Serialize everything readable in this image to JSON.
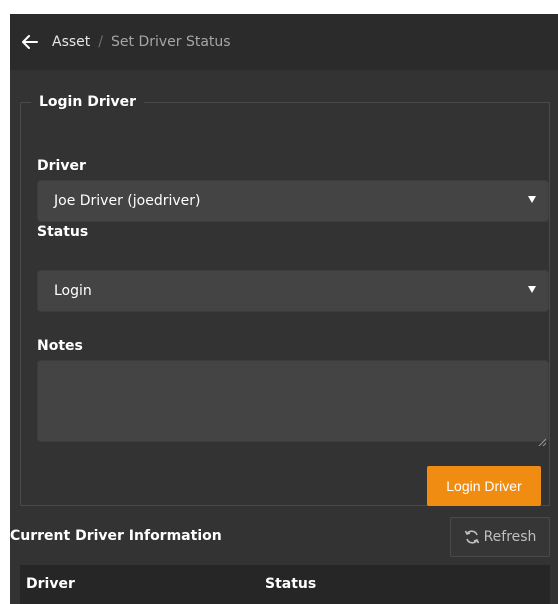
{
  "breadcrumb": {
    "parent": "Asset",
    "separator": "/",
    "current": "Set Driver Status"
  },
  "login_form": {
    "legend": "Login Driver",
    "driver_label": "Driver",
    "driver_value": "Joe Driver (joedriver)",
    "status_label": "Status",
    "status_value": "Login",
    "notes_label": "Notes",
    "notes_value": "",
    "submit_label": "Login Driver"
  },
  "current_info": {
    "title": "Current Driver Information",
    "refresh_label": "Refresh",
    "columns": [
      "Driver",
      "Status"
    ]
  },
  "colors": {
    "accent": "#f08c12",
    "panel": "#333333",
    "topbar": "#2b2b2b",
    "input": "#444444"
  },
  "icons": [
    "back-arrow-icon",
    "chevron-down-icon",
    "refresh-icon",
    "resize-grip-icon"
  ]
}
